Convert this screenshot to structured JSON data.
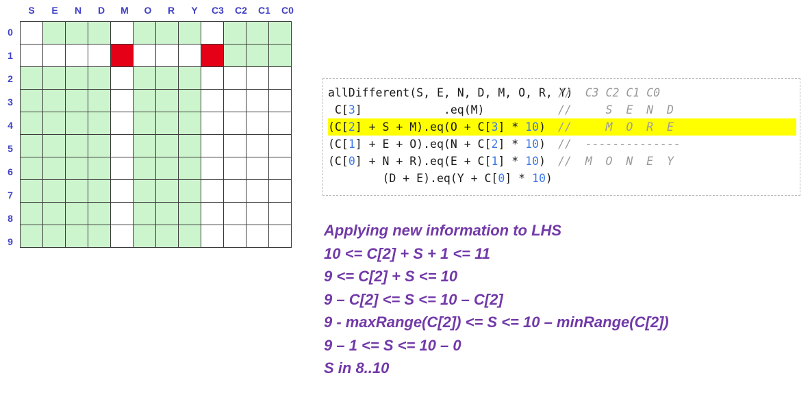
{
  "grid": {
    "columns": [
      "S",
      "E",
      "N",
      "D",
      "M",
      "O",
      "R",
      "Y",
      "C3",
      "C2",
      "C1",
      "C0"
    ],
    "rows": [
      "0",
      "1",
      "2",
      "3",
      "4",
      "5",
      "6",
      "7",
      "8",
      "9"
    ],
    "legend": {
      "green": "#cdf5cd",
      "red": "#e60017",
      "white": "#ffffff",
      "header_color": "#4040c8"
    },
    "cells": [
      [
        "white",
        "green",
        "green",
        "green",
        "white",
        "green",
        "green",
        "green",
        "white",
        "green",
        "green",
        "green"
      ],
      [
        "white",
        "white",
        "white",
        "white",
        "red",
        "white",
        "white",
        "white",
        "red",
        "green",
        "green",
        "green"
      ],
      [
        "green",
        "green",
        "green",
        "green",
        "white",
        "green",
        "green",
        "green",
        "white",
        "white",
        "white",
        "white"
      ],
      [
        "green",
        "green",
        "green",
        "green",
        "white",
        "green",
        "green",
        "green",
        "white",
        "white",
        "white",
        "white"
      ],
      [
        "green",
        "green",
        "green",
        "green",
        "white",
        "green",
        "green",
        "green",
        "white",
        "white",
        "white",
        "white"
      ],
      [
        "green",
        "green",
        "green",
        "green",
        "white",
        "green",
        "green",
        "green",
        "white",
        "white",
        "white",
        "white"
      ],
      [
        "green",
        "green",
        "green",
        "green",
        "white",
        "green",
        "green",
        "green",
        "white",
        "white",
        "white",
        "white"
      ],
      [
        "green",
        "green",
        "green",
        "green",
        "white",
        "green",
        "green",
        "green",
        "white",
        "white",
        "white",
        "white"
      ],
      [
        "green",
        "green",
        "green",
        "green",
        "white",
        "green",
        "green",
        "green",
        "white",
        "white",
        "white",
        "white"
      ],
      [
        "green",
        "green",
        "green",
        "green",
        "white",
        "green",
        "green",
        "green",
        "white",
        "white",
        "white",
        "white"
      ]
    ]
  },
  "code": {
    "highlight_color": "#ffff00",
    "number_color": "#3b78e7",
    "comment_color": "#9a9a9a",
    "lines": [
      {
        "expr_pre": "allDifferent(S, E, N, D, M, O, R, Y)",
        "comment": "//  C3 C2 C1 C0",
        "highlighted": false
      },
      {
        "expr_pre": " C[",
        "num1": "3",
        "expr_mid": "]            .eq(M)",
        "comment": "//     S  E  N  D",
        "highlighted": false
      },
      {
        "expr_pre": "(C[",
        "num1": "2",
        "expr_mid": "] + S + M).eq(O + C[",
        "num2": "3",
        "expr_post": "] * ",
        "num3": "10",
        "expr_end": ")",
        "comment": "//     M  O  R  E",
        "highlighted": true
      },
      {
        "expr_pre": "(C[",
        "num1": "1",
        "expr_mid": "] + E + O).eq(N + C[",
        "num2": "2",
        "expr_post": "] * ",
        "num3": "10",
        "expr_end": ")",
        "comment": "//  --------------",
        "highlighted": false
      },
      {
        "expr_pre": "(C[",
        "num1": "0",
        "expr_mid": "] + N + R).eq(E + C[",
        "num2": "1",
        "expr_post": "] * ",
        "num3": "10",
        "expr_end": ")",
        "comment": "//  M  O  N  E  Y",
        "highlighted": false
      },
      {
        "expr_pre": "        (D + E).eq(Y + C[",
        "num1": "0",
        "expr_mid": "] * ",
        "num3": "10",
        "expr_end": ")",
        "comment": "",
        "highlighted": false
      }
    ]
  },
  "derivation": {
    "color": "#7239a8",
    "lines": [
      "Applying new information to LHS",
      "10 <= C[2] + S + 1 <= 11",
      "9 <= C[2] + S <= 10",
      "9 – C[2] <= S <= 10 – C[2]",
      "9 - maxRange(C[2]) <= S <= 10 – minRange(C[2])",
      "9 – 1 <= S <= 10 – 0",
      "S in 8..10"
    ]
  }
}
